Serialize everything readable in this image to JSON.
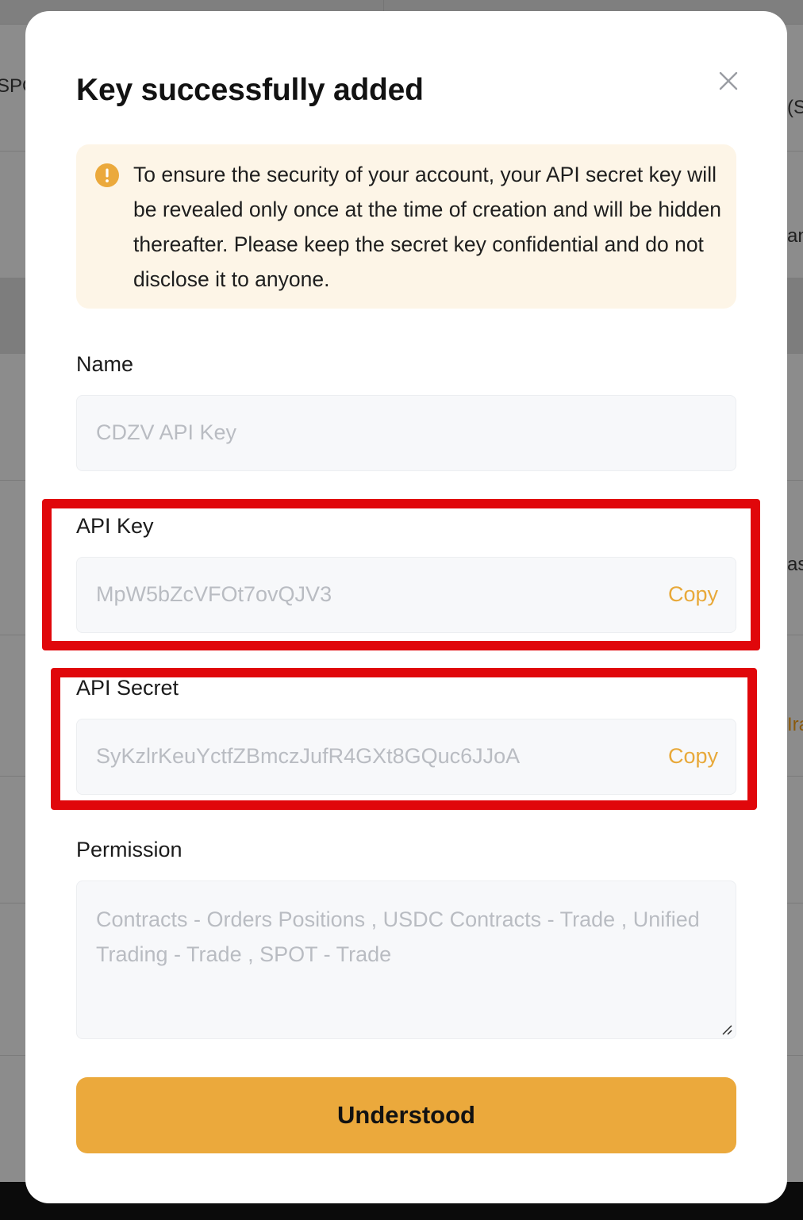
{
  "background": {
    "fragments": [
      "SPO",
      "(S",
      "an",
      "as",
      "Ira"
    ]
  },
  "modal": {
    "title": "Key successfully added",
    "close_icon": "close-icon",
    "notice": {
      "icon": "warning-icon",
      "text": "To ensure the security of your account, your API secret key will be revealed only once at the time of creation and will be hidden thereafter. Please keep the secret key confidential and do not disclose it to anyone."
    },
    "name": {
      "label": "Name",
      "value": "CDZV API Key"
    },
    "api_key": {
      "label": "API Key",
      "value": "MpW5bZcVFOt7ovQJV3",
      "copy_label": "Copy"
    },
    "api_secret": {
      "label": "API Secret",
      "value": "SyKzlrKeuYctfZBmczJufR4GXt8GQuc6JJoA",
      "copy_label": "Copy"
    },
    "permission": {
      "label": "Permission",
      "value": "Contracts - Orders Positions  , USDC Contracts - Trade  , Unified Trading - Trade  , SPOT - Trade"
    },
    "confirm_label": "Understood"
  },
  "colors": {
    "accent": "#eba93c",
    "copy_link": "#e8a93a",
    "notice_bg": "#fdf5e7",
    "highlight": "#e0070b"
  }
}
